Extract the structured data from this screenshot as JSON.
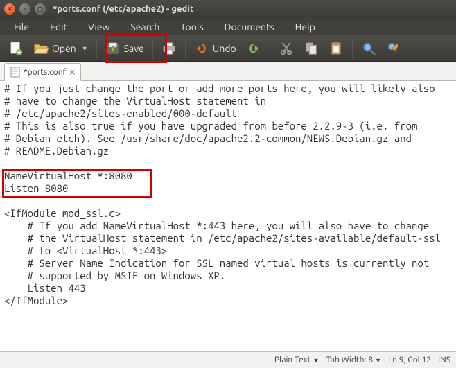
{
  "window": {
    "title": "*ports.conf (/etc/apache2) - gedit"
  },
  "menubar": {
    "file": "File",
    "edit": "Edit",
    "view": "View",
    "search": "Search",
    "tools": "Tools",
    "documents": "Documents",
    "help": "Help"
  },
  "toolbar": {
    "open": "Open",
    "save": "Save",
    "undo": "Undo"
  },
  "tab": {
    "label": "*ports.conf"
  },
  "editor": {
    "lines": "# If you just change the port or add more ports here, you will likely also\n# have to change the VirtualHost statement in\n# /etc/apache2/sites-enabled/000-default\n# This is also true if you have upgraded from before 2.2.9-3 (i.e. from\n# Debian etch). See /usr/share/doc/apache2.2-common/NEWS.Debian.gz and\n# README.Debian.gz\n\nNameVirtualHost *:8080\nListen 8080\n\n<IfModule mod_ssl.c>\n    # If you add NameVirtualHost *:443 here, you will also have to change\n    # the VirtualHost statement in /etc/apache2/sites-available/default-ssl\n    # to <VirtualHost *:443>\n    # Server Name Indication for SSL named virtual hosts is currently not\n    # supported by MSIE on Windows XP.\n    Listen 443\n</IfModule>"
  },
  "statusbar": {
    "syntax": "Plain Text",
    "tabwidth_label": "Tab Width:",
    "tabwidth_value": "8",
    "position": "Ln 9, Col 12",
    "ins": "INS"
  },
  "accent_red": "#d40000"
}
